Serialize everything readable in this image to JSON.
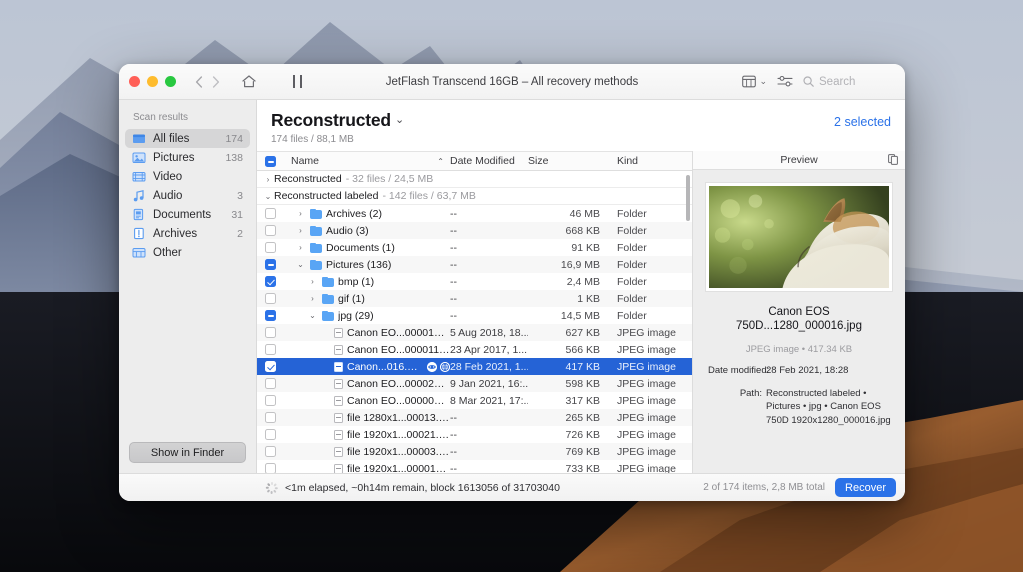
{
  "window": {
    "title": "JetFlash Transcend 16GB – All recovery methods",
    "traffic_lights": [
      "close",
      "minimize",
      "zoom"
    ],
    "nav_back": "‹",
    "nav_forward": "›",
    "home_icon": "home-icon",
    "pause_icon": "pause-icon"
  },
  "toolbar": {
    "view_icon": "calendar-view-icon",
    "view_chevron": "⌄",
    "filter_icon": "filter-sliders-icon",
    "search_icon": "search-icon",
    "search_placeholder": "Search",
    "search_value": ""
  },
  "sidebar": {
    "section_label": "Scan results",
    "items": [
      {
        "label": "All files",
        "count": "174",
        "icon": "all-files-icon",
        "active": true
      },
      {
        "label": "Pictures",
        "count": "138",
        "icon": "pictures-icon",
        "active": false
      },
      {
        "label": "Video",
        "count": "",
        "icon": "video-icon",
        "active": false
      },
      {
        "label": "Audio",
        "count": "3",
        "icon": "audio-icon",
        "active": false
      },
      {
        "label": "Documents",
        "count": "31",
        "icon": "documents-icon",
        "active": false
      },
      {
        "label": "Archives",
        "count": "2",
        "icon": "archives-icon",
        "active": false
      },
      {
        "label": "Other",
        "count": "",
        "icon": "other-icon",
        "active": false
      }
    ],
    "show_in_finder": "Show in Finder"
  },
  "main": {
    "title": "Reconstructed",
    "title_chevron": "⌄",
    "subtitle": "174 files / 88,1 MB",
    "selected_label": "2 selected",
    "accent_color": "#2b72e8"
  },
  "columns": {
    "select_all_state": "mixed",
    "name": "Name",
    "sort_caret": "⌃",
    "date_modified": "Date Modified",
    "size": "Size",
    "kind": "Kind"
  },
  "groups": [
    {
      "twisty": "›",
      "name": "Reconstructed",
      "meta": "- 32 files / 24,5 MB",
      "expanded": false
    },
    {
      "twisty": "⌄",
      "name": "Reconstructed labeled",
      "meta": "- 142 files / 63,7 MB",
      "expanded": true
    }
  ],
  "rows": [
    {
      "check": "off",
      "indent": 1,
      "twisty": "›",
      "icon": "folder-icon",
      "name": "Archives (2)",
      "date": "--",
      "size": "46 MB",
      "kind": "Folder",
      "selected": false,
      "alt": false
    },
    {
      "check": "off",
      "indent": 1,
      "twisty": "›",
      "icon": "folder-icon",
      "name": "Audio (3)",
      "date": "--",
      "size": "668 KB",
      "kind": "Folder",
      "selected": false,
      "alt": true
    },
    {
      "check": "off",
      "indent": 1,
      "twisty": "›",
      "icon": "folder-icon",
      "name": "Documents (1)",
      "date": "--",
      "size": "91 KB",
      "kind": "Folder",
      "selected": false,
      "alt": false
    },
    {
      "check": "mixed",
      "indent": 1,
      "twisty": "⌄",
      "icon": "folder-icon",
      "name": "Pictures (136)",
      "date": "--",
      "size": "16,9 MB",
      "kind": "Folder",
      "selected": false,
      "alt": true
    },
    {
      "check": "on",
      "indent": 2,
      "twisty": "›",
      "icon": "folder-icon",
      "name": "bmp (1)",
      "date": "--",
      "size": "2,4 MB",
      "kind": "Folder",
      "selected": false,
      "alt": false
    },
    {
      "check": "off",
      "indent": 2,
      "twisty": "›",
      "icon": "folder-icon",
      "name": "gif (1)",
      "date": "--",
      "size": "1 KB",
      "kind": "Folder",
      "selected": false,
      "alt": true
    },
    {
      "check": "mixed",
      "indent": 2,
      "twisty": "⌄",
      "icon": "folder-icon",
      "name": "jpg (29)",
      "date": "--",
      "size": "14,5 MB",
      "kind": "Folder",
      "selected": false,
      "alt": false
    },
    {
      "check": "off",
      "indent": 3,
      "twisty": "",
      "icon": "file-icon",
      "name": "Canon EO...000015.jpg",
      "date": "5 Aug 2018, 18...",
      "size": "627 KB",
      "kind": "JPEG image",
      "selected": false,
      "alt": true
    },
    {
      "check": "off",
      "indent": 3,
      "twisty": "",
      "icon": "file-icon",
      "name": "Canon EO...000011.jpg",
      "date": "23 Apr 2017, 1...",
      "size": "566 KB",
      "kind": "JPEG image",
      "selected": false,
      "alt": false
    },
    {
      "check": "on",
      "indent": 3,
      "twisty": "",
      "icon": "file-icon",
      "name": "Canon...016.jpg",
      "date": "28 Feb 2021, 1...",
      "size": "417 KB",
      "kind": "JPEG image",
      "selected": true,
      "alt": false,
      "badges": [
        "eye-icon",
        "globe-icon"
      ]
    },
    {
      "check": "off",
      "indent": 3,
      "twisty": "",
      "icon": "file-icon",
      "name": "Canon EO...000025.jpg",
      "date": "9 Jan 2021, 16:...",
      "size": "598 KB",
      "kind": "JPEG image",
      "selected": false,
      "alt": true
    },
    {
      "check": "off",
      "indent": 3,
      "twisty": "",
      "icon": "file-icon",
      "name": "Canon EO...000004.jpg",
      "date": "8 Mar 2021, 17:...",
      "size": "317 KB",
      "kind": "JPEG image",
      "selected": false,
      "alt": false
    },
    {
      "check": "off",
      "indent": 3,
      "twisty": "",
      "icon": "file-icon",
      "name": "file 1280x1...00013.jpg",
      "date": "--",
      "size": "265 KB",
      "kind": "JPEG image",
      "selected": false,
      "alt": true
    },
    {
      "check": "off",
      "indent": 3,
      "twisty": "",
      "icon": "file-icon",
      "name": "file 1920x1...00021.jpg",
      "date": "--",
      "size": "726 KB",
      "kind": "JPEG image",
      "selected": false,
      "alt": false
    },
    {
      "check": "off",
      "indent": 3,
      "twisty": "",
      "icon": "file-icon",
      "name": "file 1920x1...00003.jpg",
      "date": "--",
      "size": "769 KB",
      "kind": "JPEG image",
      "selected": false,
      "alt": true
    },
    {
      "check": "off",
      "indent": 3,
      "twisty": "",
      "icon": "file-icon",
      "name": "file 1920x1...000017.jpg",
      "date": "--",
      "size": "733 KB",
      "kind": "JPEG image",
      "selected": false,
      "alt": false
    }
  ],
  "preview": {
    "header": "Preview",
    "expand_icon": "detach-preview-icon",
    "image_alt": "cat-photo",
    "filename": "Canon EOS 750D...1280_000016.jpg",
    "kind_line": "JPEG image • 417.34 KB",
    "date_key": "Date modified:",
    "date_value": "28 Feb 2021, 18:28",
    "path_key": "Path:",
    "path_value": "Reconstructed labeled • Pictures • jpg • Canon EOS 750D 1920x1280_000016.jpg"
  },
  "status": {
    "spinner_icon": "progress-spinner-icon",
    "text": "<1m elapsed, ~0h14m remain, block 1613056 of 31703040",
    "count": "2 of 174 items, 2,8 MB total",
    "recover_label": "Recover"
  }
}
